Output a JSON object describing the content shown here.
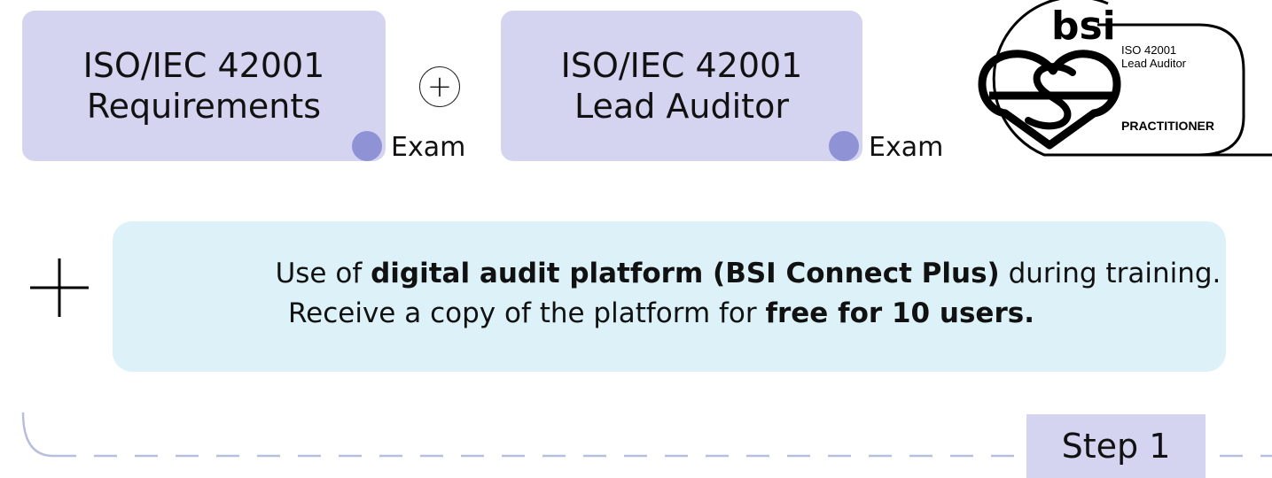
{
  "course1": {
    "line1": "ISO/IEC 42001",
    "line2": "Requirements",
    "exam_label": "Exam"
  },
  "connector_symbol": "+",
  "course2": {
    "line1": "ISO/IEC 42001",
    "line2": "Lead Auditor",
    "exam_label": "Exam"
  },
  "badge": {
    "brand": "bsi",
    "cert_line1": "ISO 42001",
    "cert_line2": "Lead Auditor",
    "level": "PRACTITIONER"
  },
  "benefit": {
    "line1_before": "Use of ",
    "line1_bold": "digital audit platform (BSI Connect Plus)",
    "line1_after": " during training.",
    "line2_before": "Receive a copy of the platform for ",
    "line2_bold": "free for 10 users."
  },
  "step": {
    "label": "Step 1"
  },
  "colors": {
    "course_box": "#d4d4f0",
    "exam_dot": "#8f93d6",
    "benefit_box": "#dcf2f8",
    "timeline": "#b8bede"
  }
}
